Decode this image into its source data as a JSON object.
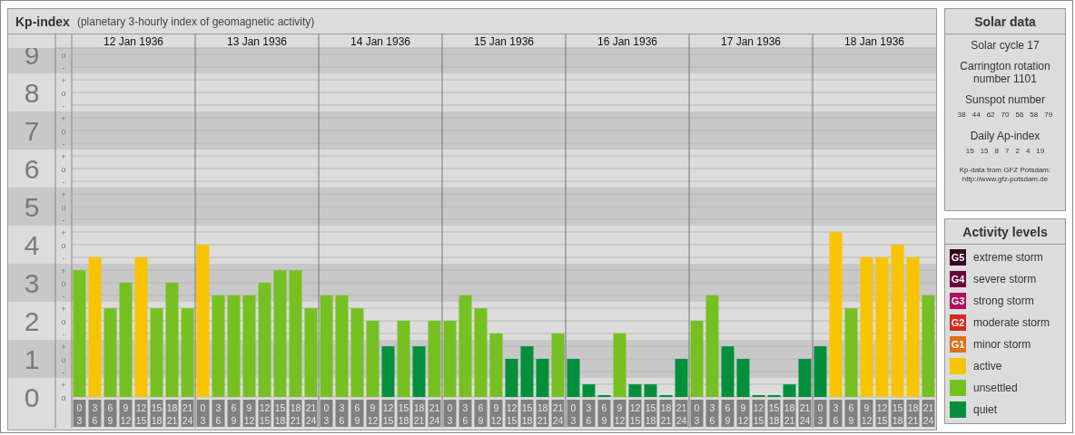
{
  "kp_panel": {
    "title": "Kp-index",
    "subtitle": "(planetary 3-hourly index of geomagnetic activity)",
    "chart_data": {
      "type": "bar",
      "stacked": true,
      "grid": true,
      "categories": [
        "0 3",
        "3 6",
        "6 9",
        "9 12",
        "12 15",
        "15 18",
        "18 21",
        "21 24",
        "0 3",
        "3 6",
        "6 9",
        "9 12",
        "12 15",
        "15 18",
        "18 21",
        "21 24",
        "0 3",
        "3 6",
        "6 9",
        "9 12",
        "12 15",
        "15 18",
        "18 21",
        "21 24",
        "0 3",
        "3 6",
        "6 9",
        "9 12",
        "12 15",
        "15 18",
        "18 21",
        "21 24",
        "0 3",
        "3 6",
        "6 9",
        "9 12",
        "12 15",
        "15 18",
        "18 21",
        "21 24",
        "0 3",
        "3 6",
        "6 9",
        "9 12",
        "12 15",
        "15 18",
        "18 21",
        "21 24",
        "0 3",
        "3 6",
        "6 9",
        "9 12",
        "12 15",
        "15 18",
        "18 21",
        "21 24"
      ],
      "ylim": [
        0,
        9
      ],
      "yticks": [
        {
          "value": 9,
          "label": "9"
        },
        {
          "value": 8,
          "label": "8"
        },
        {
          "value": 7,
          "label": "7"
        },
        {
          "value": 6,
          "label": "6"
        },
        {
          "value": 5,
          "label": "5"
        },
        {
          "value": 4,
          "label": "4"
        },
        {
          "value": 3,
          "label": "3"
        },
        {
          "value": 2,
          "label": "2"
        },
        {
          "value": 1,
          "label": "1"
        },
        {
          "value": 0,
          "label": "0"
        }
      ],
      "series": [
        {
          "name": "quiet",
          "color": "#00903c",
          "values": [
            null,
            null,
            null,
            null,
            null,
            null,
            null,
            null,
            null,
            null,
            null,
            null,
            null,
            null,
            null,
            null,
            null,
            null,
            null,
            null,
            1.33,
            null,
            1.33,
            null,
            null,
            null,
            null,
            null,
            1,
            1.33,
            1,
            null,
            1,
            0.33,
            0,
            null,
            0.33,
            0.33,
            0,
            1,
            null,
            null,
            1.33,
            1,
            0,
            0,
            0.33,
            1,
            1.33,
            null,
            null,
            null,
            null,
            null,
            null,
            null
          ]
        },
        {
          "name": "unsettled",
          "color": "#76c022",
          "values": [
            3.33,
            null,
            2.33,
            3,
            null,
            2.33,
            3,
            2.33,
            null,
            2.67,
            2.67,
            2.67,
            3,
            3.33,
            3.33,
            2.33,
            2.67,
            2.67,
            2.33,
            2,
            null,
            2,
            null,
            2,
            2,
            2.67,
            2.33,
            1.67,
            null,
            null,
            null,
            1.67,
            null,
            null,
            null,
            1.67,
            null,
            null,
            null,
            null,
            2,
            2.67,
            null,
            null,
            null,
            null,
            null,
            null,
            null,
            null,
            2.33,
            null,
            null,
            null,
            null,
            2.67
          ]
        },
        {
          "name": "active",
          "color": "#f8c400",
          "values": [
            null,
            3.67,
            null,
            null,
            3.67,
            null,
            null,
            null,
            4,
            null,
            null,
            null,
            null,
            null,
            null,
            null,
            null,
            null,
            null,
            null,
            null,
            null,
            null,
            null,
            null,
            null,
            null,
            null,
            null,
            null,
            null,
            null,
            null,
            null,
            null,
            null,
            null,
            null,
            null,
            null,
            null,
            null,
            null,
            null,
            null,
            null,
            null,
            null,
            null,
            4.33,
            null,
            3.67,
            3.67,
            4,
            3.67,
            null
          ]
        }
      ]
    },
    "days": [
      "12 Jan 1936",
      "13 Jan 1936",
      "14 Jan 1936",
      "15 Jan 1936",
      "16 Jan 1936",
      "17 Jan 1936",
      "18 Jan 1936"
    ],
    "minor_tick_labels": [
      "o",
      "-",
      "+",
      "o",
      "-",
      "+",
      "o",
      "-",
      "+",
      "o",
      "-",
      "+",
      "o",
      "-",
      "+",
      "o",
      "-",
      "+",
      "o",
      "-",
      "+",
      "o",
      "-",
      "+",
      "o",
      "-",
      "+",
      "o"
    ]
  },
  "solar_data": {
    "title": "Solar data",
    "solar_cycle": "Solar cycle 17",
    "carrington": "Carrington rotation number 1101",
    "sunspot_heading": "Sunspot number",
    "sunspots": [
      "38",
      "44",
      "62",
      "70",
      "56",
      "58",
      "79"
    ],
    "ap_heading": "Daily Ap-index",
    "ap": [
      "15",
      "15",
      "8",
      "7",
      "2",
      "4",
      "19"
    ],
    "source": "Kp-data from GFZ Potsdam:",
    "source_url": "http://www.gfz-potsdam.de"
  },
  "activity_levels": {
    "title": "Activity levels",
    "items": [
      {
        "badge": "G5",
        "label": "extreme storm",
        "color": "#3d0020"
      },
      {
        "badge": "G4",
        "label": "severe storm",
        "color": "#6a0040"
      },
      {
        "badge": "G3",
        "label": "strong storm",
        "color": "#b0105a"
      },
      {
        "badge": "G2",
        "label": "moderate storm",
        "color": "#d8281c"
      },
      {
        "badge": "G1",
        "label": "minor storm",
        "color": "#e07018"
      }
    ]
  }
}
